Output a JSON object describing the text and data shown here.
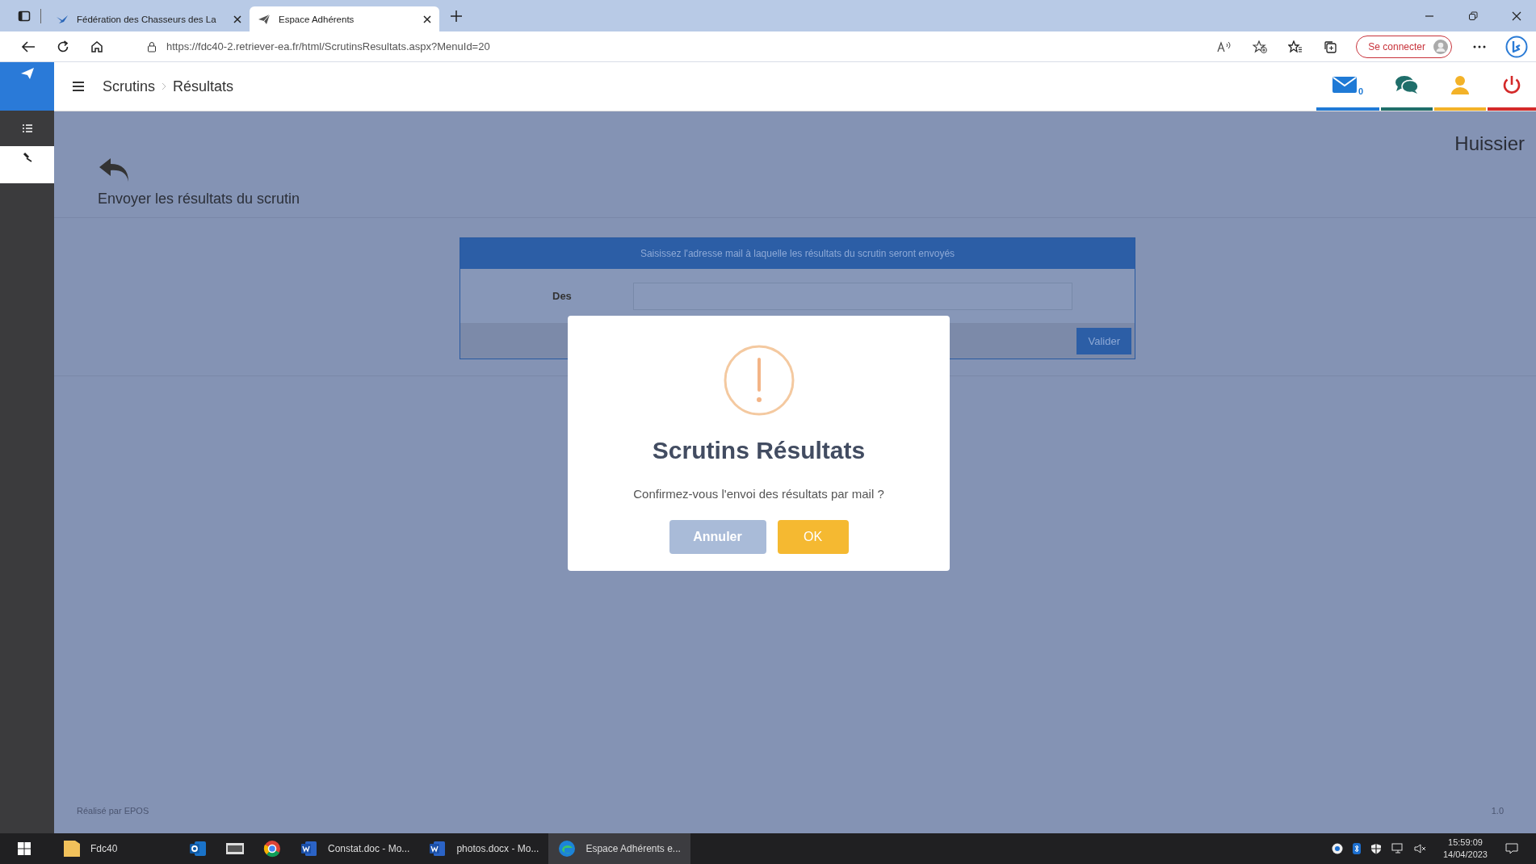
{
  "browser": {
    "tabs": [
      {
        "title": "Fédération des Chasseurs des La",
        "selected": false
      },
      {
        "title": "Espace Adhérents",
        "selected": true
      }
    ],
    "url": "https://fdc40-2.retriever-ea.fr/html/ScrutinsResultats.aspx?MenuId=20",
    "sign_in": "Se connecter"
  },
  "header": {
    "breadcrumb": [
      "Scrutins",
      "Résultats"
    ],
    "mail_count": "0"
  },
  "sidebar": {
    "items": [
      {
        "kind": "list",
        "selected": false
      },
      {
        "kind": "gavel",
        "selected": true
      }
    ]
  },
  "page": {
    "role": "Huissier",
    "title": "Envoyer les résultats du scrutin"
  },
  "form": {
    "header": "Saisissez l'adresse mail à laquelle les résultats du scrutin seront envoyés",
    "field_label": "Des",
    "submit": "Valider"
  },
  "dialog": {
    "title": "Scrutins Résultats",
    "message": "Confirmez-vous l'envoi des résultats par mail ?",
    "buttons": [
      {
        "label": "Annuler",
        "kind": "cancel"
      },
      {
        "label": "OK",
        "kind": "confirm"
      }
    ]
  },
  "footer": {
    "credit": "Réalisé par EPOS",
    "version": "1.0"
  },
  "taskbar": {
    "apps": [
      {
        "kind": "folder",
        "label": "Fdc40",
        "selected": false
      },
      {
        "kind": "mail",
        "selected": false
      },
      {
        "kind": "app",
        "selected": false
      },
      {
        "kind": "browser",
        "selected": false
      },
      {
        "kind": "word",
        "label": "Constat.doc  -  Mo...",
        "selected": false
      },
      {
        "kind": "word",
        "label": "photos.docx  -  Mo...",
        "selected": false
      },
      {
        "kind": "edge",
        "label": "Espace Adhérents e...",
        "selected": true
      }
    ],
    "time": "15:59:09",
    "date": "14/04/2023"
  }
}
